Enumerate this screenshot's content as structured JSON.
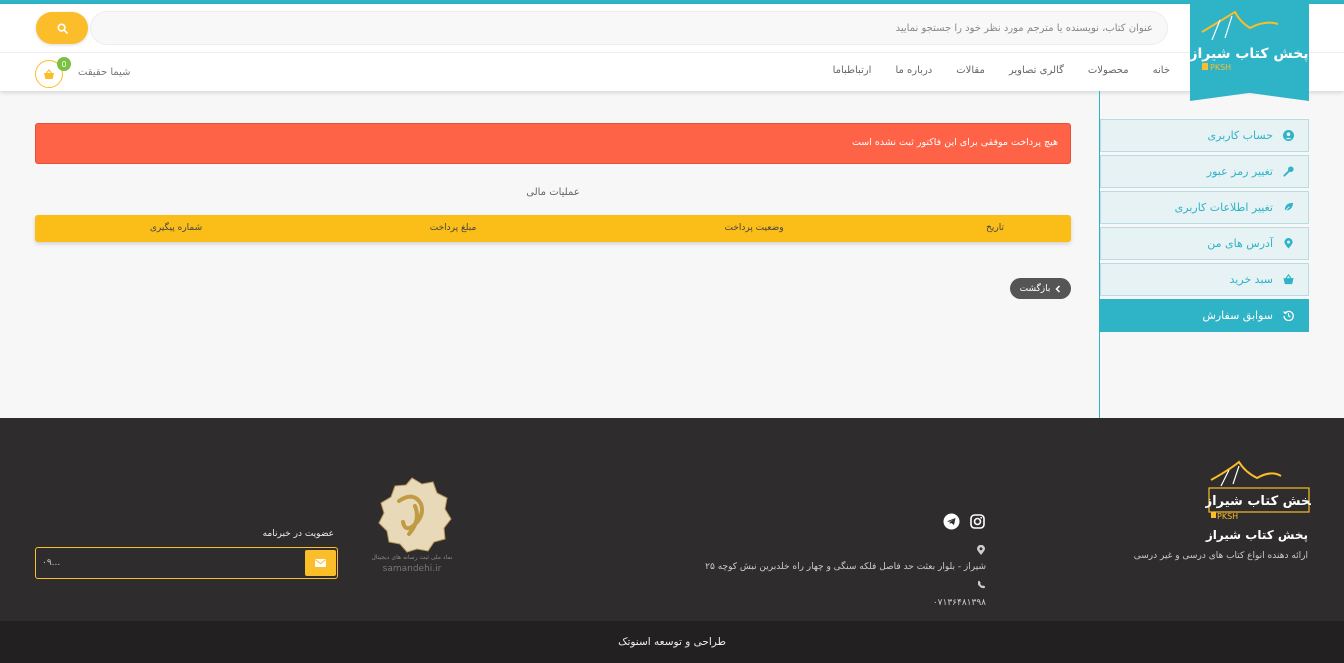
{
  "header": {
    "search_placeholder": "عنوان کتاب، نویسنده یا مترجم مورد نظر خود را جستجو نمایید",
    "nav": [
      "خانه",
      "محصولات",
      "گالری تصاویر",
      "مقالات",
      "درباره ما",
      "ارتباطباما"
    ],
    "user_name": "شیما حقیقت",
    "cart_count": "0",
    "logo_text": "پخش کتاب شیراز",
    "logo_sub": "PKSH",
    "accent": "#2fb3c6",
    "brand_yellow": "#fbbd29"
  },
  "sidebar": {
    "items": [
      {
        "label": "حساب کاربری",
        "icon": "user-circle-icon"
      },
      {
        "label": "تغییر رمز عبور",
        "icon": "key-icon"
      },
      {
        "label": "تغییر اطلاعات کاربری",
        "icon": "leaf-icon"
      },
      {
        "label": "آدرس های من",
        "icon": "map-pin-icon"
      },
      {
        "label": "سبد خرید",
        "icon": "basket-icon"
      },
      {
        "label": "سوابق سفارش",
        "icon": "history-icon"
      }
    ]
  },
  "main": {
    "alert": "هیچ پرداخت موفقی برای این فاکتور ثبت نشده است",
    "alert_color": "#fe6347",
    "section_title": "عملیات مالی",
    "table_headers": [
      "تاریخ",
      "وضعیت پرداخت",
      "مبلغ پرداخت",
      "شماره پیگیری"
    ],
    "back_label": "بازگشت"
  },
  "footer": {
    "brand_name": "پخش کتاب شیراز",
    "brand_desc": "ارائه دهنده انواع کتاب های درسی و غیر درسی",
    "address": "شیراز - بلوار بعثت حد فاصل فلکه سنگی و چهار راه خلدبرین نبش کوچه ۲۵",
    "phone": "۰۷۱۳۶۴۸۱۳۹۸",
    "seal_caption": "samandehi.ir",
    "newsletter_label": "عضویت در خبرنامه",
    "newsletter_value": "۰۹...",
    "credit": "طراحی و توسعه اسنوتک"
  }
}
